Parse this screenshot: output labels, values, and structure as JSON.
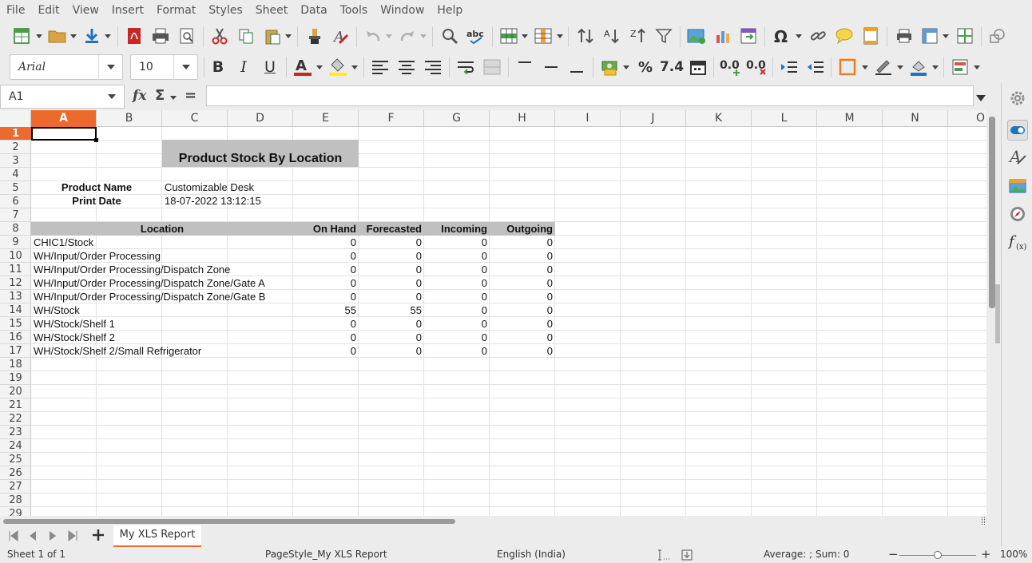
{
  "menu": [
    "File",
    "Edit",
    "View",
    "Insert",
    "Format",
    "Styles",
    "Sheet",
    "Data",
    "Tools",
    "Window",
    "Help"
  ],
  "toolbar": {
    "font_name": "Arial",
    "font_size": "10",
    "bold_label": "B",
    "italic_label": "I",
    "underline_label": "U",
    "percent_label": "%",
    "number_label": "7.4",
    "add_decimal_label": "0.0",
    "delete_decimal_label": "0.0",
    "omega_label": "Ω",
    "abc_label": "abc"
  },
  "formula_bar": {
    "name_box": "A1",
    "fx_label": "fx",
    "sigma_label": "Σ",
    "equals_label": "=",
    "content": ""
  },
  "columns": [
    "A",
    "B",
    "C",
    "D",
    "E",
    "F",
    "G",
    "H",
    "I",
    "J",
    "K",
    "L",
    "M",
    "N",
    "O"
  ],
  "active_column": "A",
  "rows": [
    "1",
    "2",
    "3",
    "4",
    "5",
    "6",
    "7",
    "8",
    "9",
    "10",
    "11",
    "12",
    "13",
    "14",
    "15",
    "16",
    "17",
    "18",
    "19",
    "20",
    "21",
    "22",
    "23",
    "24",
    "25",
    "26",
    "27",
    "28",
    "29"
  ],
  "active_row": "1",
  "report": {
    "title": "Product Stock By Location",
    "product_name_label": "Product Name",
    "product_name_value": "Customizable Desk",
    "print_date_label": "Print Date",
    "print_date_value": "18-07-2022 13:12:15",
    "headers": {
      "location": "Location",
      "on_hand": "On Hand",
      "forecasted": "Forecasted",
      "incoming": "Incoming",
      "outgoing": "Outgoing"
    },
    "rows": [
      {
        "location": "CHIC1/Stock",
        "on_hand": "0",
        "forecasted": "0",
        "incoming": "0",
        "outgoing": "0"
      },
      {
        "location": "WH/Input/Order Processing",
        "on_hand": "0",
        "forecasted": "0",
        "incoming": "0",
        "outgoing": "0"
      },
      {
        "location": "WH/Input/Order Processing/Dispatch Zone",
        "on_hand": "0",
        "forecasted": "0",
        "incoming": "0",
        "outgoing": "0"
      },
      {
        "location": "WH/Input/Order Processing/Dispatch Zone/Gate A",
        "on_hand": "0",
        "forecasted": "0",
        "incoming": "0",
        "outgoing": "0"
      },
      {
        "location": "WH/Input/Order Processing/Dispatch Zone/Gate B",
        "on_hand": "0",
        "forecasted": "0",
        "incoming": "0",
        "outgoing": "0"
      },
      {
        "location": "WH/Stock",
        "on_hand": "55",
        "forecasted": "55",
        "incoming": "0",
        "outgoing": "0"
      },
      {
        "location": "WH/Stock/Shelf 1",
        "on_hand": "0",
        "forecasted": "0",
        "incoming": "0",
        "outgoing": "0"
      },
      {
        "location": "WH/Stock/Shelf 2",
        "on_hand": "0",
        "forecasted": "0",
        "incoming": "0",
        "outgoing": "0"
      },
      {
        "location": "WH/Stock/Shelf 2/Small Refrigerator",
        "on_hand": "0",
        "forecasted": "0",
        "incoming": "0",
        "outgoing": "0"
      }
    ]
  },
  "sheet_tab": "My XLS Report",
  "status": {
    "sheet": "Sheet 1 of 1",
    "page_style": "PageStyle_My XLS Report",
    "language": "English (India)",
    "summary": "Average: ; Sum: 0",
    "zoom": "100%",
    "zoom_level": 100
  },
  "colors": {
    "accent": "#ec6a2b",
    "header_fill": "#c0c0c0",
    "title_fill": "#c0c0c0"
  }
}
